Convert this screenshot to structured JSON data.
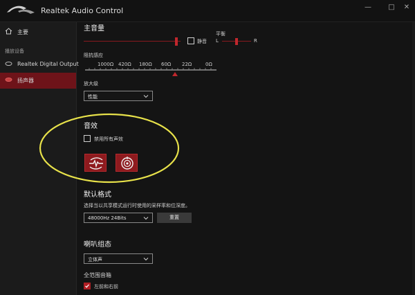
{
  "app": {
    "title": "Realtek Audio Control"
  },
  "window": {
    "minimize": "—",
    "maximize": "□",
    "close": "✕"
  },
  "sidebar": {
    "home_label": "主要",
    "section_label": "播放设备",
    "devices": [
      {
        "label": "Realtek Digital Output",
        "icon": "speaker-output-icon",
        "active": false
      },
      {
        "label": "扬声器",
        "icon": "speaker-icon",
        "active": true
      }
    ]
  },
  "main_volume": {
    "title": "主音量",
    "level_percent": 96,
    "mute_label": "静音",
    "muted": false,
    "balance_label": "平衡",
    "balance_left": "L",
    "balance_right": "R",
    "balance_position_percent": 50
  },
  "impedance": {
    "title": "阻抗感应",
    "ticks": [
      "1000Ω",
      "420Ω",
      "180Ω",
      "60Ω",
      "22Ω",
      "0Ω"
    ],
    "marker_between": "60Ω-22Ω"
  },
  "amplifier": {
    "title": "放大级",
    "selected": "性能"
  },
  "effects": {
    "title": "音效",
    "disable_all_label": "禁用所有声效",
    "disable_all_checked": false,
    "buttons": [
      {
        "icon": "bass-boost-icon"
      },
      {
        "icon": "surround-icon"
      }
    ]
  },
  "default_format": {
    "title": "默认格式",
    "description": "选择当以共享模式运行时使用的采样率和位深度。",
    "selected": "48000Hz 24Bits",
    "reset_label": "重置"
  },
  "speaker_config": {
    "title": "喇叭组态",
    "selected": "立体声"
  },
  "full_range": {
    "title": "全范围音箱",
    "front_label": "左前和右前",
    "front_checked": true
  },
  "colors": {
    "accent": "#b01e24",
    "active_sidebar": "#6e1319",
    "annotation": "#e8e24a"
  }
}
